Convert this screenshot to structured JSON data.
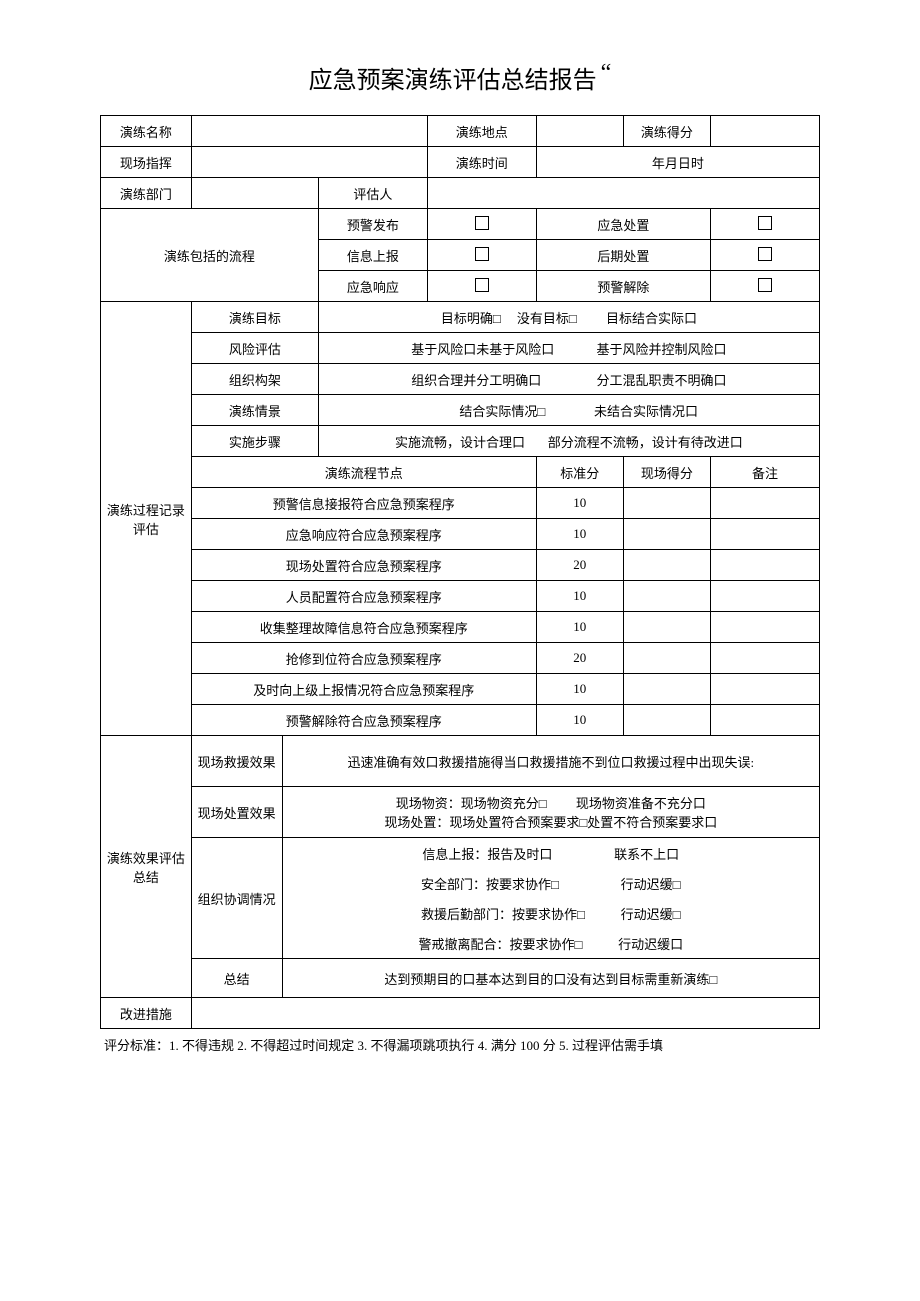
{
  "title": "应急预案演练评估总结报告",
  "title_mark": "“",
  "header": {
    "name_label": "演练名称",
    "location_label": "演练地点",
    "score_label": "演练得分",
    "commander_label": "现场指挥",
    "time_label": "演练时间",
    "time_value": "年月日时",
    "dept_label": "演练部门",
    "evaluator_label": "评估人"
  },
  "flow": {
    "section_label": "演练包括的流程",
    "rows": [
      {
        "l": "预警发布",
        "r": "应急处置"
      },
      {
        "l": "信息上报",
        "r": "后期处置"
      },
      {
        "l": "应急响应",
        "r": "预警解除"
      }
    ]
  },
  "process": {
    "section_label": "演练过程记录评估",
    "criteria": {
      "goal": {
        "label": "演练目标",
        "a": "目标明确□",
        "b": "没有目标□",
        "c": "目标结合实际口"
      },
      "risk": {
        "label": "风险评估",
        "a": "基于风险口未基于风险口",
        "b": "基于风险并控制风险口"
      },
      "org": {
        "label": "组织构架",
        "a": "组织合理并分工明确口",
        "b": "分工混乱职责不明确口"
      },
      "scene": {
        "label": "演练情景",
        "a": "结合实际情况□",
        "b": "未结合实际情况口"
      },
      "steps": {
        "label": "实施步骤",
        "a": "实施流畅，设计合理口",
        "b": "部分流程不流畅，设计有待改进口"
      }
    },
    "table_header": {
      "node": "演练流程节点",
      "std": "标准分",
      "site": "现场得分",
      "remark": "备注"
    },
    "nodes": [
      {
        "name": "预警信息接报符合应急预案程序",
        "score": "10"
      },
      {
        "name": "应急响应符合应急预案程序",
        "score": "10"
      },
      {
        "name": "现场处置符合应急预案程序",
        "score": "20"
      },
      {
        "name": "人员配置符合应急预案程序",
        "score": "10"
      },
      {
        "name": "收集整理故障信息符合应急预案程序",
        "score": "10"
      },
      {
        "name": "抢修到位符合应急预案程序",
        "score": "20"
      },
      {
        "name": "及时向上级上报情况符合应急预案程序",
        "score": "10"
      },
      {
        "name": "预警解除符合应急预案程序",
        "score": "10"
      }
    ]
  },
  "effect": {
    "section_label": "演练效果评估总结",
    "rescue": {
      "label": "现场救援效果",
      "text": "迅速准确有效口救援措施得当口救援措施不到位口救援过程中出现失误:"
    },
    "dispose": {
      "label": "现场处置效果",
      "line1a": "现场物资：现场物资充分□",
      "line1b": "现场物资准备不充分口",
      "line2": "现场处置：现场处置符合预案要求□处置不符合预案要求口"
    },
    "coord": {
      "label": "组织协调情况",
      "l1a": "信息上报：报告及时口",
      "l1b": "联系不上口",
      "l2a": "安全部门：按要求协作□",
      "l2b": "行动迟缓□",
      "l3a": "救援后勤部门：按要求协作□",
      "l3b": "行动迟缓□",
      "l4a": "警戒撤离配合：按要求协作□",
      "l4b": "行动迟缓口"
    },
    "summary": {
      "label": "总结",
      "text": "达到预期目的口基本达到目的口没有达到目标需重新演练□"
    }
  },
  "improve": {
    "label": "改进措施"
  },
  "footnote": "评分标准：1. 不得违规 2. 不得超过时间规定 3. 不得漏项跳项执行 4. 满分 100 分 5. 过程评估需手填"
}
